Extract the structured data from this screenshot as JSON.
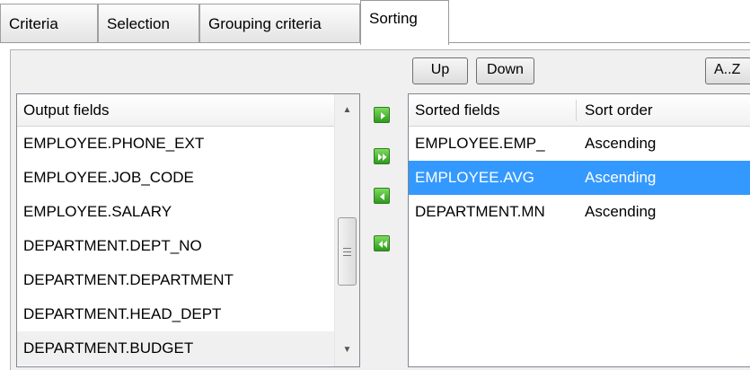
{
  "tabs": [
    {
      "label": "Criteria",
      "active": false
    },
    {
      "label": "Selection",
      "active": false
    },
    {
      "label": "Grouping criteria",
      "active": false
    },
    {
      "label": "Sorting",
      "active": true
    }
  ],
  "toolbar": {
    "up_label": "Up",
    "down_label": "Down",
    "az_label": "A..Z"
  },
  "output_fields": {
    "header": "Output fields",
    "items": [
      "EMPLOYEE.PHONE_EXT",
      "EMPLOYEE.JOB_CODE",
      "EMPLOYEE.SALARY",
      "DEPARTMENT.DEPT_NO",
      "DEPARTMENT.DEPARTMENT",
      "DEPARTMENT.HEAD_DEPT",
      "DEPARTMENT.BUDGET"
    ],
    "hovered_index": 6
  },
  "sorted_fields": {
    "header_field": "Sorted fields",
    "header_order": "Sort order",
    "rows": [
      {
        "field": "EMPLOYEE.EMP_",
        "order": "Ascending",
        "selected": false
      },
      {
        "field": "EMPLOYEE.AVG",
        "order": "Ascending",
        "selected": true
      },
      {
        "field": "DEPARTMENT.MN",
        "order": "Ascending",
        "selected": false
      }
    ]
  },
  "move_buttons": [
    {
      "icon": "move-right-icon"
    },
    {
      "icon": "move-all-right-icon"
    },
    {
      "icon": "move-left-icon"
    },
    {
      "icon": "move-all-left-icon"
    }
  ],
  "colors": {
    "selection": "#3399ff",
    "move_button_green": "#2f9a1f"
  }
}
